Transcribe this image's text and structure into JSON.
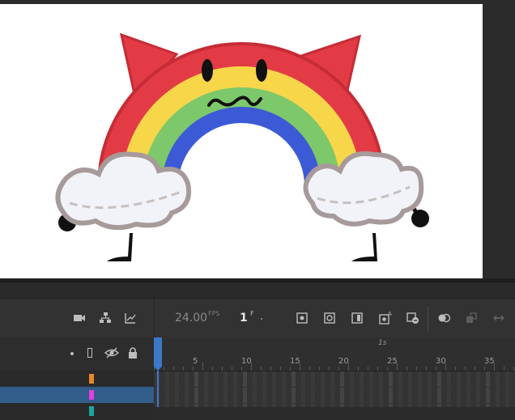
{
  "colors": {
    "rainbow": [
      "#e23b45",
      "#f7d64a",
      "#7cc86a",
      "#3d5ad6",
      "#2a3ec4"
    ],
    "horn": "#e23b45",
    "cloud_fill": "#f1f3f8",
    "cloud_stroke": "#a79a9a",
    "selected_layer": "#325c8a",
    "playhead": "#3b78c8"
  },
  "toolbar": {
    "icons": [
      "camera-icon",
      "layer-hierarchy-icon",
      "graph-icon",
      "onion-skin-icon",
      "onion-skin-outline-icon",
      "edit-multiple-frames-icon",
      "insert-keyframe-icon",
      "delete-frame-icon",
      "tween-icon",
      "convert-to-keyframe-icon",
      "loop-icon"
    ],
    "fps_value": "24.00",
    "fps_unit": "FPS",
    "frame_value": "1",
    "frame_unit": "F"
  },
  "layers_header": {
    "icons": [
      "dot-icon",
      "outline-icon",
      "visibility-eye-icon",
      "lock-icon"
    ]
  },
  "layers": [
    {
      "color": "#e8862a",
      "selected": false
    },
    {
      "color": "#e040e0",
      "selected": true
    },
    {
      "color": "#1aa7a0",
      "selected": false
    }
  ],
  "ruler": {
    "labels": [
      "5",
      "10",
      "15",
      "20",
      "25",
      "30",
      "35"
    ],
    "second_label": "1s"
  }
}
